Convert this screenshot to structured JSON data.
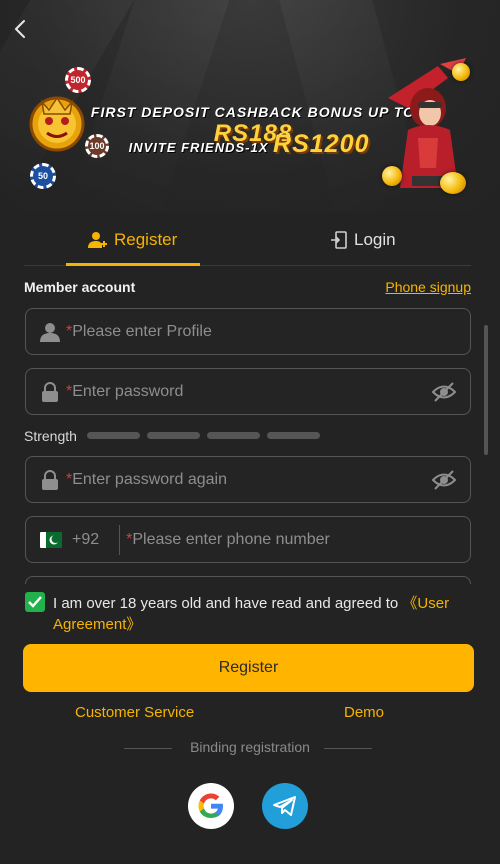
{
  "banner": {
    "promo_line1": "FIRST DEPOSIT CASHBACK BONUS UP TO",
    "promo_amount1": "RS188",
    "promo_line2": "INVITE FRIENDS-1X",
    "promo_amount2": "RS1200",
    "chip_500": "500",
    "chip_100": "100",
    "chip_50": "50"
  },
  "tabs": {
    "register": "Register",
    "login": "Login"
  },
  "form": {
    "section_title": "Member account",
    "phone_signup": "Phone signup",
    "profile_placeholder": "Please enter Profile",
    "password_placeholder": "Enter password",
    "strength_label": "Strength",
    "password_again_placeholder": "Enter password again",
    "country_code": "+92",
    "phone_placeholder": "Please enter phone number",
    "required_mark": "*"
  },
  "agreement": {
    "checked": true,
    "text": "I am over 18 years old and have read and agreed to ",
    "link": "《User Agreement》"
  },
  "actions": {
    "register_button": "Register",
    "customer_service": "Customer Service",
    "demo": "Demo",
    "binding_registration": "Binding registration"
  },
  "colors": {
    "accent": "#f6b400",
    "button": "#ffb400",
    "check": "#22b24c",
    "required": "#e53935"
  }
}
